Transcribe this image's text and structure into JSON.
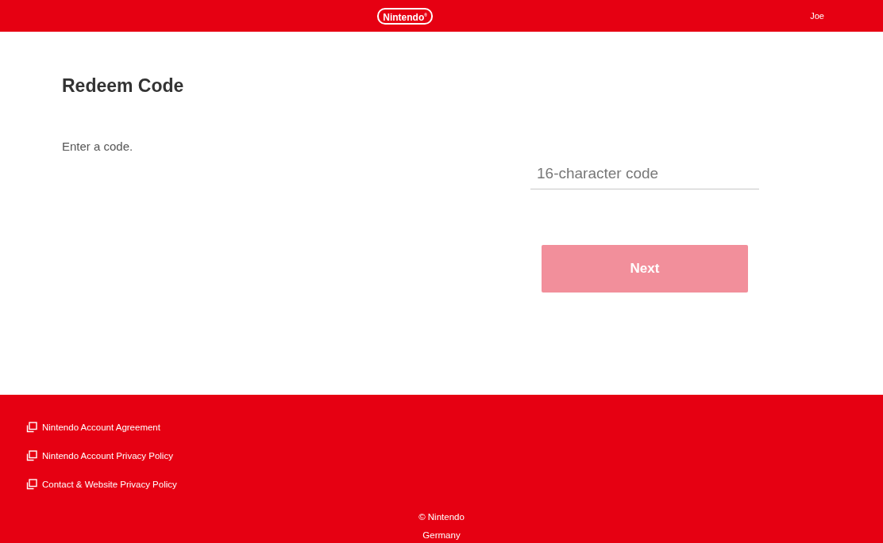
{
  "header": {
    "logo": "Nintendo$^{®}$",
    "user": "Joe"
  },
  "main": {
    "title": "Redeem Code",
    "instruction": "Enter a code.",
    "code_field": {
      "placeholder": "16-character code"
    },
    "next_button": {
      "label": "Next",
      "disabled": true
    }
  },
  "footer": {
    "links": [
      {
        "label": "Nintendo Account Agreement"
      },
      {
        "label": "Nintendo Account Privacy Policy"
      },
      {
        "label": "Contact & Website Privacy Policy"
      }
    ],
    "copyright": "© Nintendo",
    "region": "Germany"
  }
}
